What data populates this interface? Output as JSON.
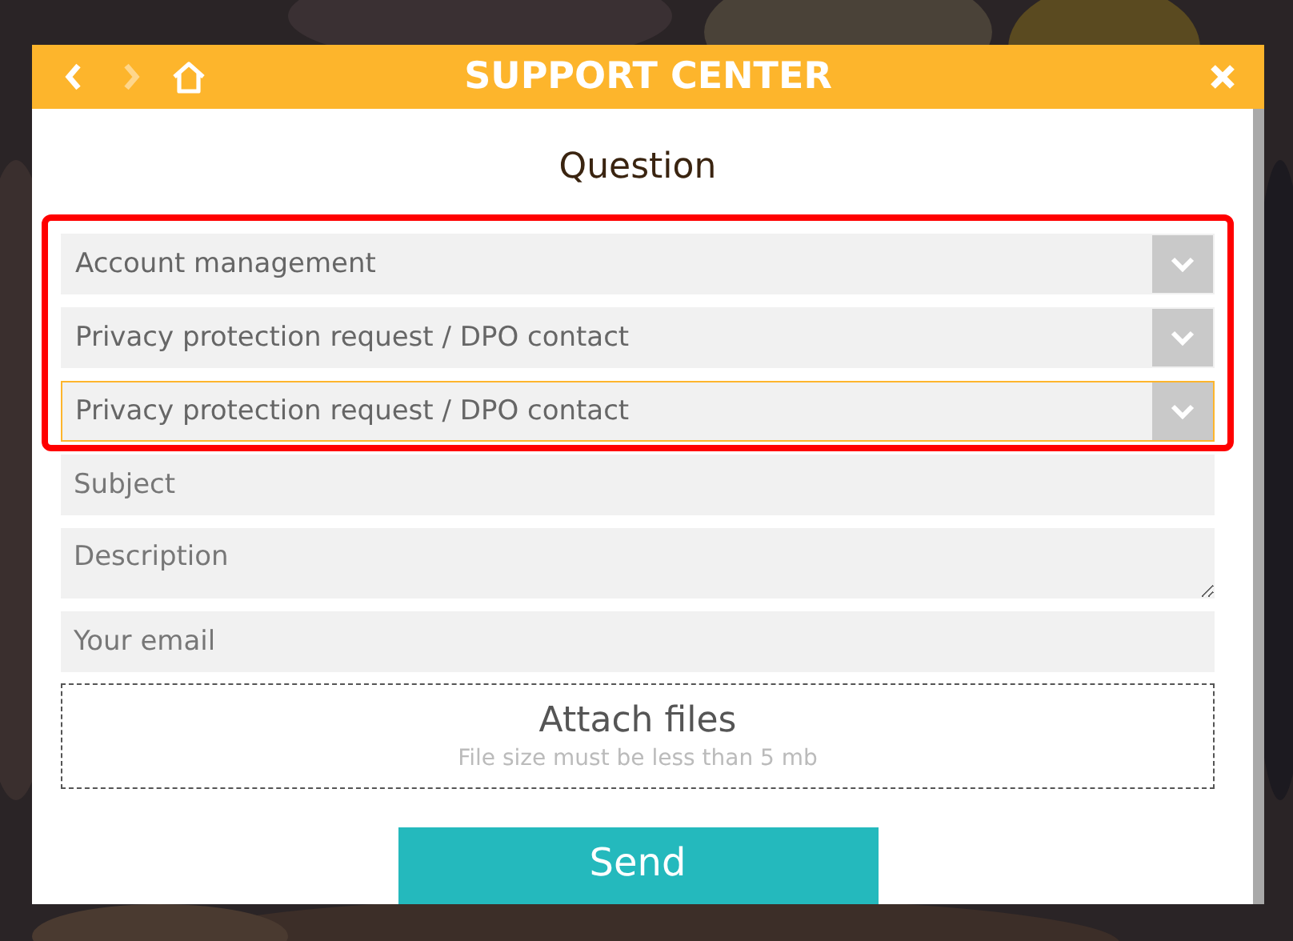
{
  "header": {
    "title": "SUPPORT CENTER",
    "back": {
      "disabled": false
    },
    "forward": {
      "disabled": true
    }
  },
  "form_title": "Question",
  "category_group": {
    "highlighted": true
  },
  "categories": [
    {
      "value": "Account management",
      "focused": false
    },
    {
      "value": "Privacy protection request / DPO contact",
      "focused": false
    },
    {
      "value": "Privacy protection request / DPO contact",
      "focused": true
    }
  ],
  "fields": [
    {
      "kind": "input",
      "placeholder": "Subject"
    },
    {
      "kind": "textarea",
      "placeholder": "Description"
    },
    {
      "kind": "input",
      "placeholder": "Your email"
    }
  ],
  "attach": {
    "title": "Attach files",
    "note": "File size must be less than 5 mb"
  },
  "send_button": "Send"
}
